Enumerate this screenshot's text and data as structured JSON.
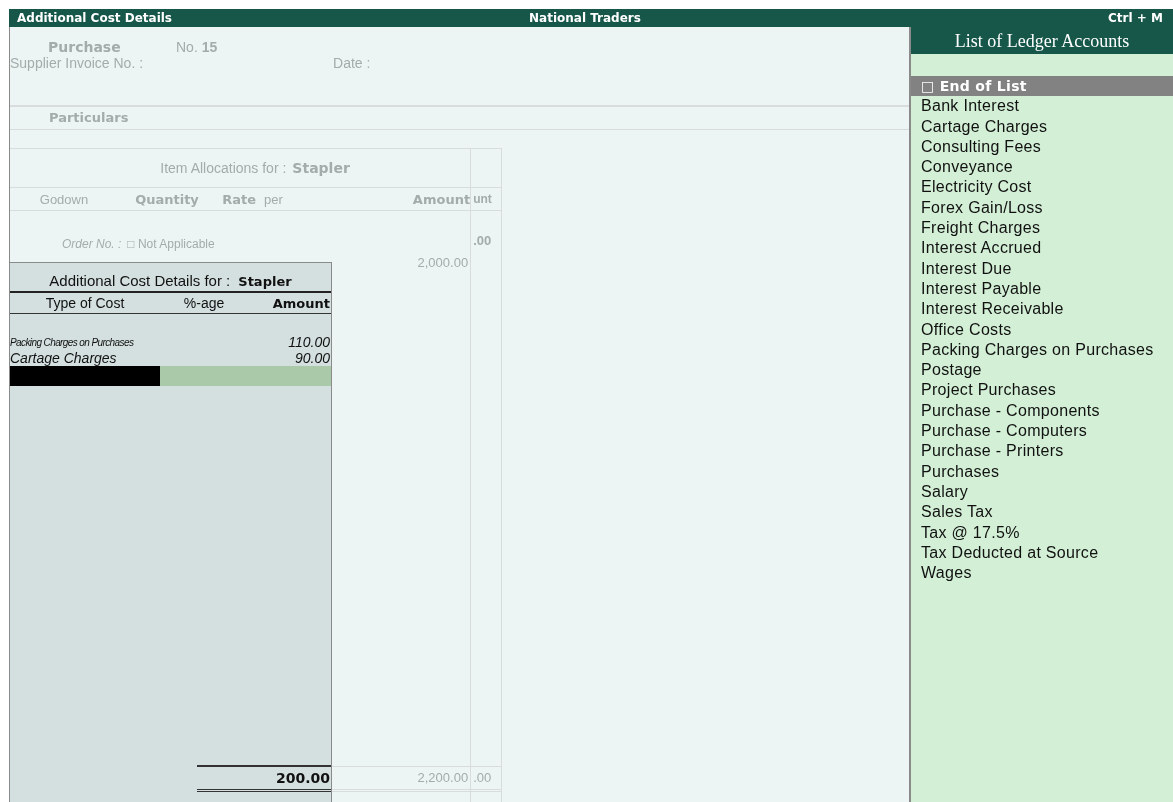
{
  "title_bar": {
    "title": "Additional Cost Details",
    "company": "National Traders",
    "shortcut": "Ctrl + M"
  },
  "voucher": {
    "type": "Purchase",
    "number_label": "No.",
    "number": "15",
    "supplier_invoice_label": "Supplier Invoice No. :",
    "date_label": "Date :",
    "particulars_header": "Particulars"
  },
  "item_allocations": {
    "title_label": "Item Allocations for :",
    "item": "Stapler",
    "columns": [
      {
        "label": "Godown",
        "bold": false
      },
      {
        "label": "Quantity",
        "bold": true
      },
      {
        "label": "Rate",
        "bold": true
      },
      {
        "label": "per",
        "bold": false
      },
      {
        "label": "Amount",
        "bold": true
      }
    ],
    "side_column": "unt",
    "order_label": "Order No. :",
    "order_value": "□ Not Applicable",
    "side_amount": ".00",
    "amount": "2,000.00",
    "total": "2,200.00",
    "side_total": ".00"
  },
  "additional_costs": {
    "title_label": "Additional Cost Details for :",
    "item": "Stapler",
    "columns": [
      {
        "label": "Type of Cost",
        "bold": false
      },
      {
        "label": "%-age",
        "bold": false
      },
      {
        "label": "Amount",
        "bold": true
      }
    ],
    "rows": [
      {
        "type": "Packing Charges on Purchases",
        "amount": "110.00",
        "kind": "condensed"
      },
      {
        "type": "Cartage Charges",
        "amount": "90.00",
        "kind": "normal"
      }
    ],
    "input_row": {
      "active": true
    },
    "total": "200.00"
  },
  "ledger_list": {
    "title": "List of Ledger Accounts",
    "items": [
      {
        "label": "□ End of List",
        "selected": true
      },
      {
        "label": "Bank Interest",
        "selected": false
      },
      {
        "label": "Cartage Charges",
        "selected": false
      },
      {
        "label": "Consulting Fees",
        "selected": false
      },
      {
        "label": "Conveyance",
        "selected": false
      },
      {
        "label": "Electricity Cost",
        "selected": false
      },
      {
        "label": "Forex Gain/Loss",
        "selected": false
      },
      {
        "label": "Freight Charges",
        "selected": false
      },
      {
        "label": "Interest Accrued",
        "selected": false
      },
      {
        "label": "Interest Due",
        "selected": false
      },
      {
        "label": "Interest Payable",
        "selected": false
      },
      {
        "label": "Interest Receivable",
        "selected": false
      },
      {
        "label": "Office Costs",
        "selected": false
      },
      {
        "label": "Packing Charges on Purchases",
        "selected": false
      },
      {
        "label": "Postage",
        "selected": false
      },
      {
        "label": "Project Purchases",
        "selected": false
      },
      {
        "label": "Purchase - Components",
        "selected": false
      },
      {
        "label": "Purchase - Computers",
        "selected": false
      },
      {
        "label": "Purchase - Printers",
        "selected": false
      },
      {
        "label": "Purchases",
        "selected": false
      },
      {
        "label": "Salary",
        "selected": false
      },
      {
        "label": "Sales Tax",
        "selected": false
      },
      {
        "label": "Tax @ 17.5%",
        "selected": false
      },
      {
        "label": "Tax Deducted at Source",
        "selected": false
      },
      {
        "label": "Wages",
        "selected": false
      }
    ]
  }
}
